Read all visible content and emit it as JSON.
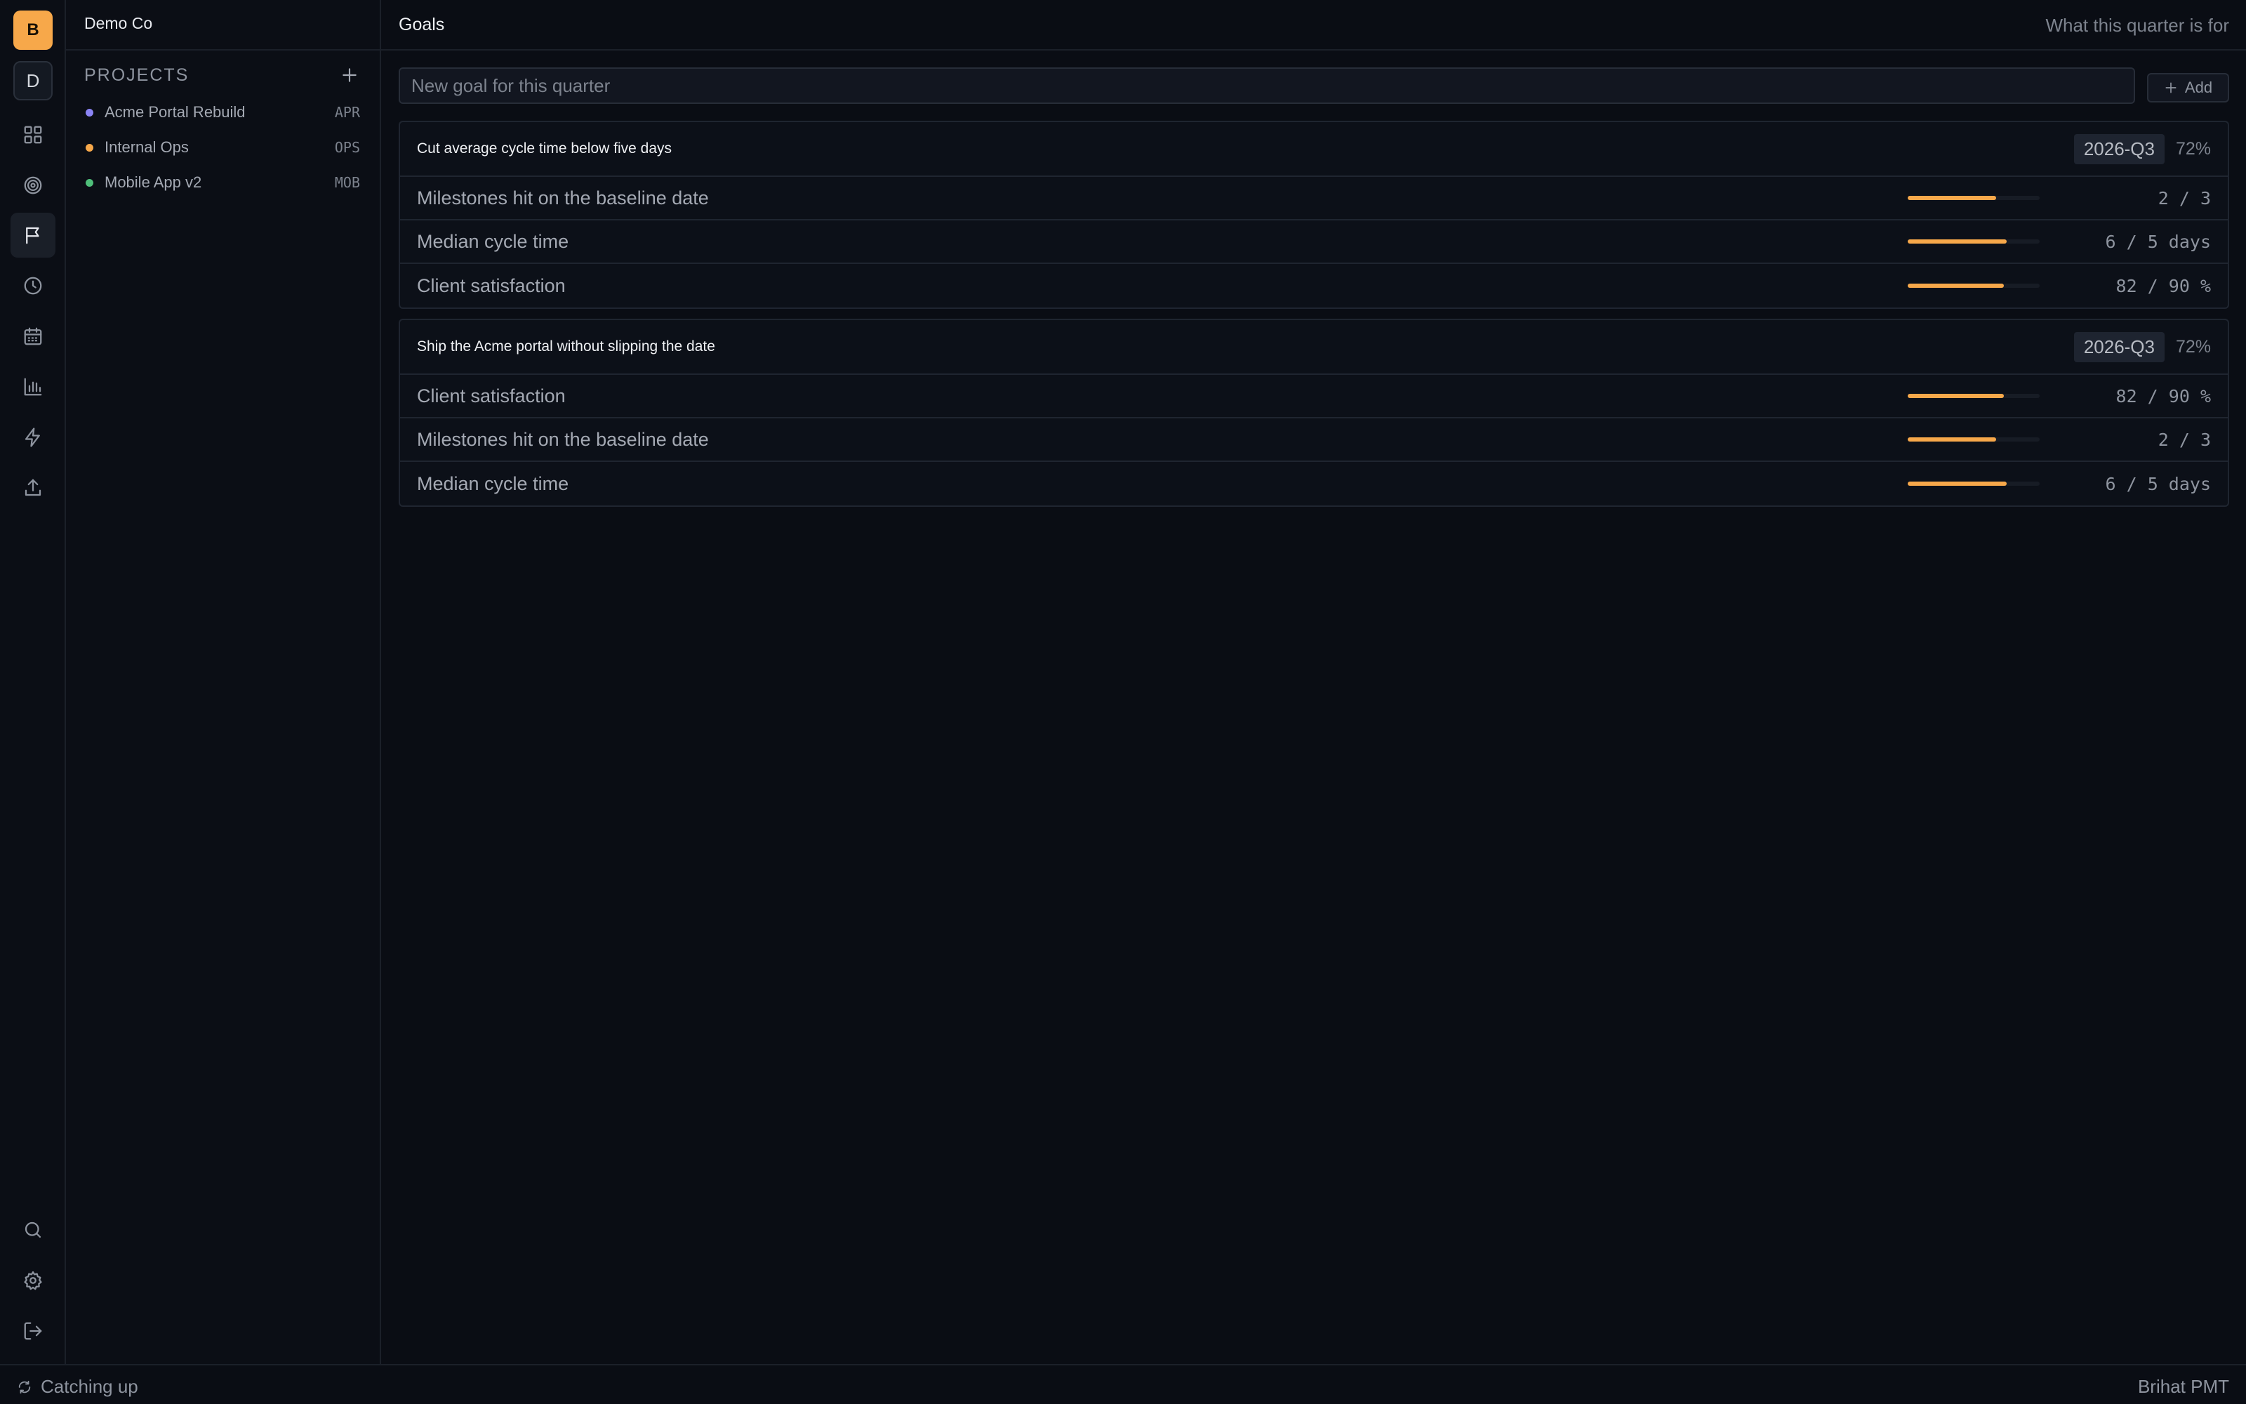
{
  "app": {
    "brand_letter": "B",
    "workspace_letter": "D",
    "org_name": "Demo Co",
    "footer_brand": "Brihat PMT"
  },
  "colors": {
    "accent": "#f7a84a",
    "background": "#0a0d14"
  },
  "rail": {
    "top_icons": [
      "grid-icon",
      "target-icon",
      "flag-icon",
      "clock-icon",
      "calendar-icon",
      "bar-chart-icon",
      "lightning-icon",
      "upload-icon"
    ],
    "active_icon": "flag-icon",
    "bottom_icons": [
      "search-icon",
      "gear-icon",
      "logout-icon"
    ]
  },
  "sidebar": {
    "projects_header": "PROJECTS",
    "projects": [
      {
        "name": "Acme Portal Rebuild",
        "code": "APR",
        "color": "#8b84f5"
      },
      {
        "name": "Internal Ops",
        "code": "OPS",
        "color": "#f7a84a"
      },
      {
        "name": "Mobile App v2",
        "code": "MOB",
        "color": "#4fbf7a"
      }
    ]
  },
  "header": {
    "title": "Goals",
    "subtitle": "What this quarter is for"
  },
  "new_goal": {
    "placeholder": "New goal for this quarter",
    "value": "",
    "add_label": "Add"
  },
  "goals": [
    {
      "title": "Cut average cycle time below five days",
      "quarter": "2026-Q3",
      "progress": "72%",
      "metrics": [
        {
          "name": "Milestones hit on the baseline date",
          "value": "2 / 3",
          "fill": 0.67
        },
        {
          "name": "Median cycle time",
          "value": "6 / 5 days",
          "fill": 0.75
        },
        {
          "name": "Client satisfaction",
          "value": "82 / 90 %",
          "fill": 0.73
        }
      ]
    },
    {
      "title": "Ship the Acme portal without slipping the date",
      "quarter": "2026-Q3",
      "progress": "72%",
      "metrics": [
        {
          "name": "Client satisfaction",
          "value": "82 / 90 %",
          "fill": 0.73
        },
        {
          "name": "Milestones hit on the baseline date",
          "value": "2 / 3",
          "fill": 0.67
        },
        {
          "name": "Median cycle time",
          "value": "6 / 5 days",
          "fill": 0.75
        }
      ]
    }
  ],
  "status": {
    "sync_label": "Catching up"
  }
}
